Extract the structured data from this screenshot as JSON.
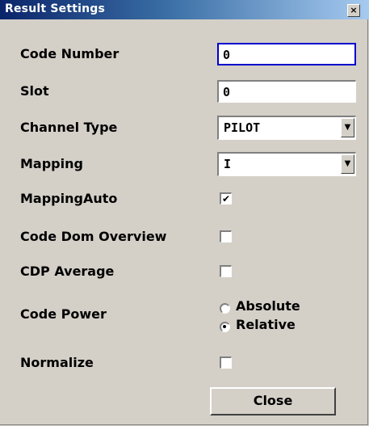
{
  "window": {
    "title": "Result Settings",
    "close_glyph": "×"
  },
  "fields": {
    "code_number": {
      "label": "Code Number",
      "value": "0"
    },
    "slot": {
      "label": "Slot",
      "value": "0"
    },
    "channel_type": {
      "label": "Channel Type",
      "value": "PILOT"
    },
    "mapping": {
      "label": "Mapping",
      "value": "I"
    },
    "mapping_auto": {
      "label": "MappingAuto",
      "checked": true,
      "mark": "✔"
    },
    "code_dom_overview": {
      "label": "Code Dom Overview",
      "checked": false
    },
    "cdp_average": {
      "label": "CDP Average",
      "checked": false
    },
    "code_power": {
      "label": "Code Power",
      "options": [
        "Absolute",
        "Relative"
      ],
      "selected": "Relative"
    },
    "normalize": {
      "label": "Normalize",
      "checked": false
    }
  },
  "buttons": {
    "close": "Close"
  },
  "icons": {
    "dropdown_arrow": "chevron-down-icon",
    "close": "close-icon"
  }
}
